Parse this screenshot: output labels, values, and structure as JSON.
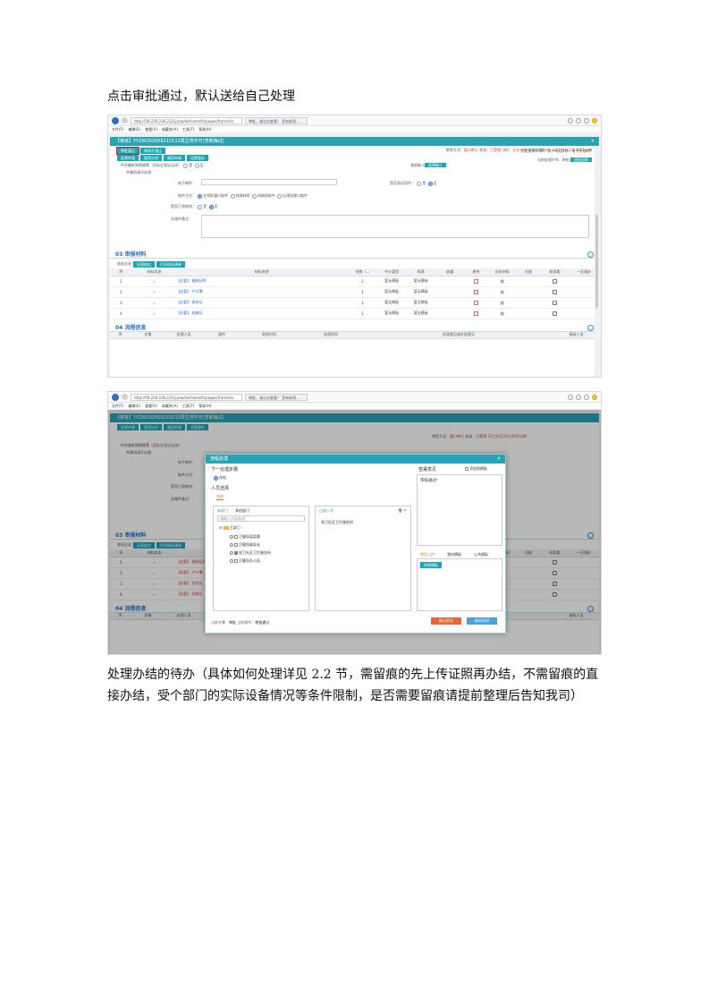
{
  "intro_text": "点击审批通过，默认送给自己处理",
  "conclusion_text": "处理办结的待办（具体如何处理详见 2.2 节，需留痕的先上传证照再办结，不需留痕的直接办结，受个部门的实际设备情况等条件限制，是否需要留痕请提前整理后告知我司）",
  "browser": {
    "address": "http://59.230.236.232/yyzw/wsframe/fs/pages/frames/z",
    "tab_title": "审批，请点击查看！ 您有新到...",
    "menu": [
      "文件(F)",
      "编辑(E)",
      "查看(V)",
      "收藏夹(A)",
      "工具(T)",
      "帮助(H)"
    ]
  },
  "window": {
    "title": "【审批】YYZW202009210132再生育许可(李莉梅试)"
  },
  "toolbar": {
    "approve_button": "审批通过",
    "return_button": "审核不通过",
    "buttons_row2": [
      "延期申请",
      "暂停计时",
      "撤回申请",
      "设置督办"
    ]
  },
  "status": {
    "prefix": "审签方式：",
    "mode": "窗口审记",
    "state_label": "状态：",
    "state": "已受理",
    "timing_label": "计时：",
    "timing": "正在计时",
    "remain_label": "剩余办理时间：",
    "remain": "12工作日23小时55分钟",
    "node_label": "当前处理环节：审批",
    "flow_button": "流程追踪"
  },
  "form": {
    "row1_label": "符合最新到期政策（否标志领证自动）",
    "row1_tail": "共事项请不办理",
    "yes": "是",
    "no": "否",
    "applicant_label": "我表被人：",
    "applicant_button": "选择被人",
    "email_label": "电子邮件：",
    "result_label": "是否测试用件：",
    "pickup_label": "取件方式：",
    "pickup_options": [
      "在领取窗口取件",
      "快递邮寄",
      "网络指取件",
      "办理结果口取件"
    ],
    "delivered_label": "是否已领物流：",
    "remarks_label": "办理件备注："
  },
  "materials": {
    "section_title": "03 审报材料",
    "select_all": "收选全选",
    "btn_verify": "证照核实",
    "btn_print": "打印材料清单",
    "summary": "已提交4件/4件，其中电话4件，电子文档0件",
    "columns": [
      "序",
      "材料状态",
      "材料名称",
      "份数（...",
      "中介类型",
      "样表",
      "收据",
      "原件",
      "历史材料",
      "扫描",
      "样表看",
      "一证通办"
    ],
    "rows": [
      {
        "no": "1",
        "name": "【必要】 婚姻证明",
        "copies": "1",
        "agency": "暂无模板",
        "sample": "暂无模板"
      },
      {
        "no": "2",
        "name": "【必要】 户口簿",
        "copies": "1",
        "agency": "暂无模板",
        "sample": "暂无模板"
      },
      {
        "no": "3",
        "name": "【必要】 身份证",
        "copies": "1",
        "agency": "暂无模板",
        "sample": "暂无模板"
      },
      {
        "no": "4",
        "name": "【必要】 结婚证",
        "copies": "1",
        "agency": "暂无模板",
        "sample": "暂无模板"
      }
    ]
  },
  "flow_info": {
    "section_title": "04 流程信息",
    "columns": [
      "序",
      "步骤",
      "处理人员",
      "操作",
      "收到时间",
      "处理时间",
      "处理意见或外部意见",
      "接收人员"
    ]
  },
  "dialog": {
    "title": "流程处理",
    "next_step_header": "下一处理步骤",
    "next_step_option": "办结",
    "person_header": "人员选择",
    "person_tab": "办结",
    "tab_my_dept": "本部门",
    "tab_other_dept": "其他部门",
    "selected_tab": "已选人员",
    "search_placeholder": "请输入内容查询",
    "tree_root": "卫部门",
    "tree_items": [
      "卫健局县监督",
      "卫健局副局长",
      "农卫社区卫生服务所",
      "卫健局办公局"
    ],
    "selected_person": "农卫社区卫生服务所",
    "opinion_header": "签署意见",
    "add_template": "添加到模板",
    "opinion_text": "审核通过!",
    "tmpl_tabs": [
      "常用上传",
      "我的模板",
      "公共模板"
    ],
    "tmpl_item": "快速模板",
    "footer_step_label": "当前步骤：",
    "footer_step": "审批",
    "footer_action_label": "当前操作：",
    "footer_action": "审批通过",
    "confirm_button": "确认提交",
    "cancel_button": "取消关闭"
  },
  "colors": {
    "teal": "#29a3b4",
    "blue": "#2672c4",
    "red": "#d32020"
  }
}
